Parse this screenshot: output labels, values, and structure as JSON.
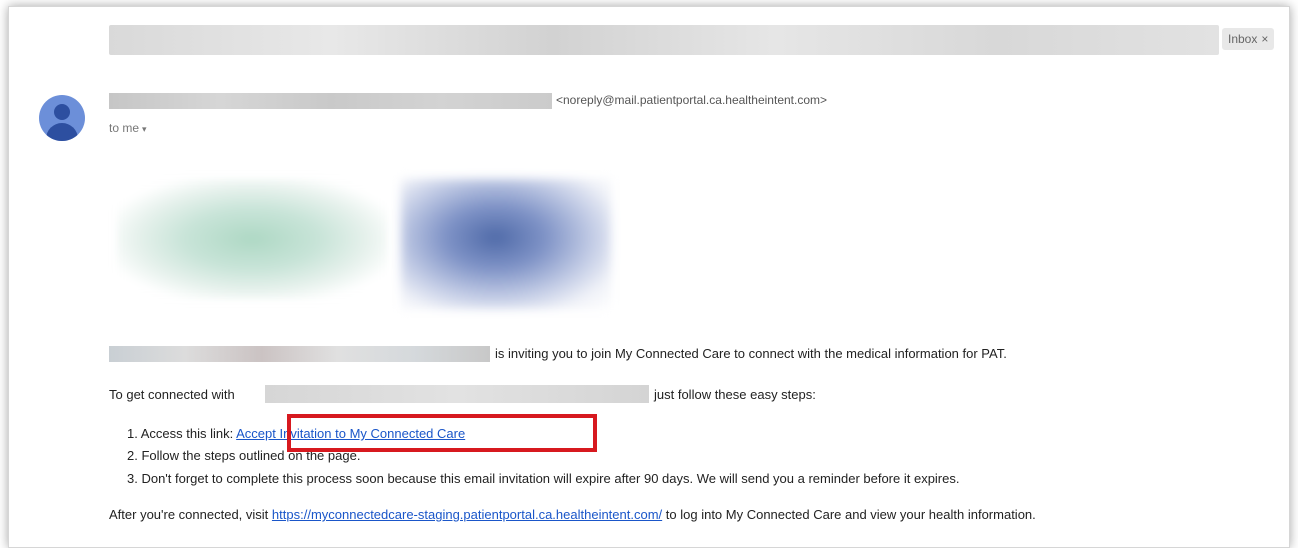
{
  "email": {
    "inbox_label": "Inbox",
    "inbox_close": "×",
    "sender_email": "<noreply@mail.patientportal.ca.healtheintent.com>",
    "recipient_label": "to me",
    "recipient_caret": "▾"
  },
  "body": {
    "invite_text": "is inviting you to join My Connected Care to connect with the medical information for PAT.",
    "get_connected_prefix": "To get connected with",
    "get_connected_suffix": "just follow these easy steps:",
    "steps": [
      {
        "prefix": "1. Access this link:",
        "link": "Accept Invitation to My Connected Care"
      },
      {
        "text": "2. Follow the steps outlined on the page."
      },
      {
        "text": "3. Don't forget to complete this process soon because this email invitation will expire after 90 days. We will send you a reminder before it expires."
      }
    ],
    "after_prefix": "After you're connected, visit",
    "portal_url": "https://myconnectedcare-staging.patientportal.ca.healtheintent.com/",
    "after_suffix": "to log into My Connected Care and view your health information."
  },
  "colors": {
    "link": "#1a56c9",
    "highlight": "#d7191f",
    "avatar_bg": "#6c8fd9",
    "avatar_fg": "#2d4fa0"
  },
  "icons": {
    "avatar": "person-avatar-icon",
    "caret": "chevron-down-icon",
    "close": "close-icon"
  }
}
